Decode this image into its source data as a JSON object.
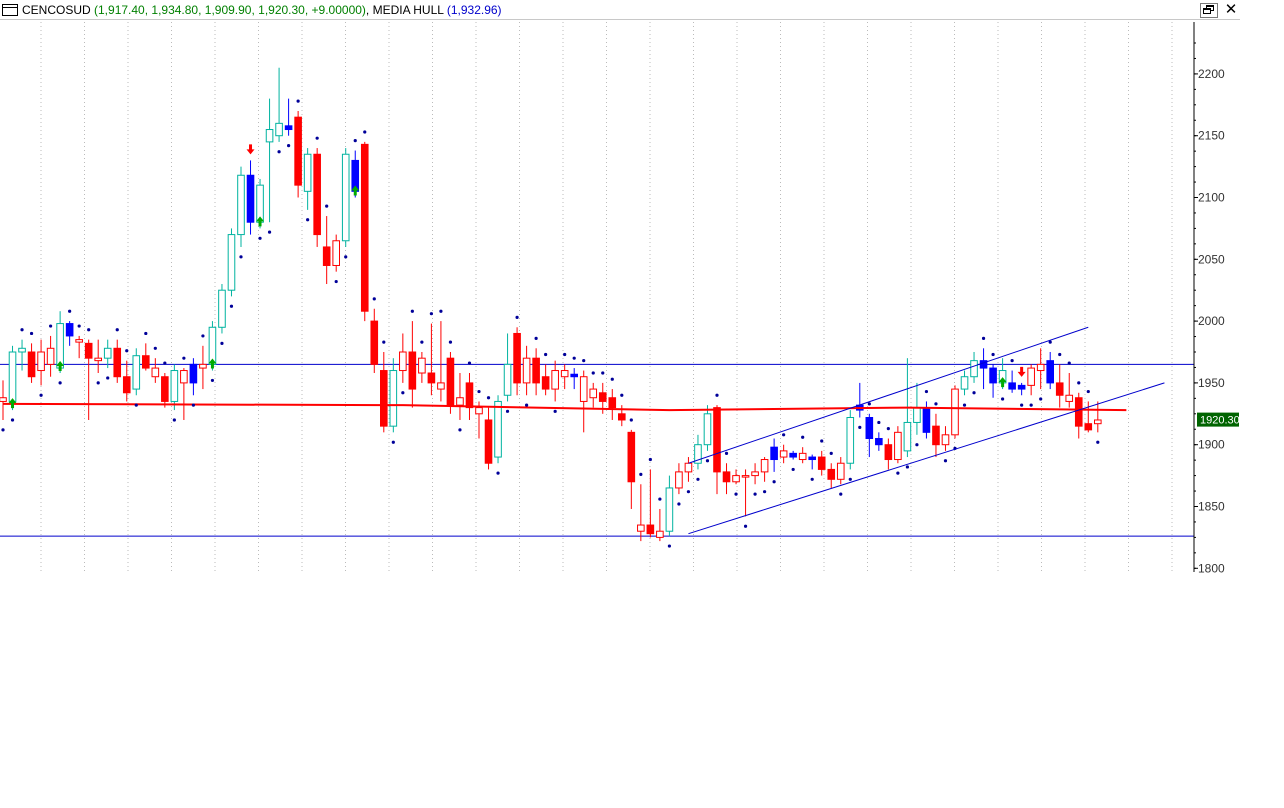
{
  "title": {
    "symbol": "CENCOSUD",
    "ohlc": "(1,917.40, 1,934.80, 1,909.90, 1,920.30, +9.00000)",
    "indicator_name": ", MEDIA HULL",
    "indicator_value": "(1,932.96)"
  },
  "window_buttons": {
    "restore_icon": "restore-icon",
    "close": "✕"
  },
  "chart_data": {
    "type": "candlestick",
    "ylim": [
      1797,
      2242
    ],
    "yticks": [
      1800,
      1850,
      1900,
      1950,
      2000,
      2050,
      2100,
      2150,
      2200
    ],
    "ytick_labels": [
      "1800",
      "1850",
      "1900",
      "1950",
      "2000",
      "2050",
      "2100",
      "2150",
      "2200"
    ],
    "last_price_label": "1920.30",
    "last_price": 1920.3,
    "colors": {
      "up_strong": "#0000ff",
      "down_strong": "#ff0000",
      "up_light": "#00b3a0",
      "down_light": "#ff0000",
      "grid": "#bbbbbb",
      "hull": "#ff0000",
      "parabolic": "#000099",
      "trend": "#0000cc",
      "signal_up": "#00aa00",
      "signal_down": "#ff0000",
      "price_tag": "#006400"
    },
    "candles": [
      {
        "o": 1935,
        "h": 1952,
        "l": 1920,
        "c": 1938,
        "s": "down_light"
      },
      {
        "o": 1935,
        "h": 1980,
        "l": 1928,
        "c": 1975,
        "s": "up_light"
      },
      {
        "o": 1978,
        "h": 1985,
        "l": 1960,
        "c": 1975,
        "s": "up_light"
      },
      {
        "o": 1975,
        "h": 1982,
        "l": 1950,
        "c": 1955,
        "s": "down_strong"
      },
      {
        "o": 1960,
        "h": 1985,
        "l": 1948,
        "c": 1975,
        "s": "down_light"
      },
      {
        "o": 1978,
        "h": 1988,
        "l": 1955,
        "c": 1965,
        "s": "down_light"
      },
      {
        "o": 1962,
        "h": 2008,
        "l": 1958,
        "c": 1998,
        "s": "up_light"
      },
      {
        "o": 1998,
        "h": 2000,
        "l": 1980,
        "c": 1988,
        "s": "up_strong"
      },
      {
        "o": 1985,
        "h": 1988,
        "l": 1970,
        "c": 1983,
        "s": "down_light"
      },
      {
        "o": 1982,
        "h": 1985,
        "l": 1920,
        "c": 1970,
        "s": "down_strong"
      },
      {
        "o": 1968,
        "h": 1985,
        "l": 1958,
        "c": 1970,
        "s": "down_light"
      },
      {
        "o": 1970,
        "h": 1985,
        "l": 1962,
        "c": 1978,
        "s": "up_light"
      },
      {
        "o": 1978,
        "h": 1985,
        "l": 1950,
        "c": 1955,
        "s": "down_strong"
      },
      {
        "o": 1955,
        "h": 1968,
        "l": 1935,
        "c": 1942,
        "s": "down_strong"
      },
      {
        "o": 1945,
        "h": 1978,
        "l": 1940,
        "c": 1972,
        "s": "up_light"
      },
      {
        "o": 1972,
        "h": 1982,
        "l": 1960,
        "c": 1962,
        "s": "down_strong"
      },
      {
        "o": 1962,
        "h": 1970,
        "l": 1950,
        "c": 1955,
        "s": "down_light"
      },
      {
        "o": 1955,
        "h": 1958,
        "l": 1930,
        "c": 1935,
        "s": "down_strong"
      },
      {
        "o": 1935,
        "h": 1965,
        "l": 1928,
        "c": 1960,
        "s": "up_light"
      },
      {
        "o": 1960,
        "h": 1962,
        "l": 1920,
        "c": 1950,
        "s": "down_light"
      },
      {
        "o": 1950,
        "h": 1970,
        "l": 1940,
        "c": 1965,
        "s": "up_strong"
      },
      {
        "o": 1965,
        "h": 1980,
        "l": 1945,
        "c": 1962,
        "s": "down_light"
      },
      {
        "o": 1965,
        "h": 2000,
        "l": 1960,
        "c": 1995,
        "s": "up_light"
      },
      {
        "o": 1995,
        "h": 2030,
        "l": 1990,
        "c": 2025,
        "s": "up_light"
      },
      {
        "o": 2025,
        "h": 2075,
        "l": 2020,
        "c": 2070,
        "s": "up_light"
      },
      {
        "o": 2070,
        "h": 2125,
        "l": 2060,
        "c": 2118,
        "s": "up_light"
      },
      {
        "o": 2118,
        "h": 2130,
        "l": 2070,
        "c": 2080,
        "s": "up_strong"
      },
      {
        "o": 2080,
        "h": 2115,
        "l": 2075,
        "c": 2110,
        "s": "up_light"
      },
      {
        "o": 2145,
        "h": 2180,
        "l": 2080,
        "c": 2155,
        "s": "up_light"
      },
      {
        "o": 2150,
        "h": 2205,
        "l": 2145,
        "c": 2160,
        "s": "up_light"
      },
      {
        "o": 2155,
        "h": 2180,
        "l": 2150,
        "c": 2158,
        "s": "up_strong"
      },
      {
        "o": 2165,
        "h": 2170,
        "l": 2100,
        "c": 2110,
        "s": "down_strong"
      },
      {
        "o": 2105,
        "h": 2140,
        "l": 2090,
        "c": 2135,
        "s": "up_light"
      },
      {
        "o": 2135,
        "h": 2140,
        "l": 2060,
        "c": 2070,
        "s": "down_strong"
      },
      {
        "o": 2060,
        "h": 2085,
        "l": 2030,
        "c": 2045,
        "s": "down_strong"
      },
      {
        "o": 2045,
        "h": 2070,
        "l": 2040,
        "c": 2065,
        "s": "down_light"
      },
      {
        "o": 2065,
        "h": 2140,
        "l": 2060,
        "c": 2135,
        "s": "up_light"
      },
      {
        "o": 2130,
        "h": 2138,
        "l": 2100,
        "c": 2105,
        "s": "up_strong"
      },
      {
        "o": 2143,
        "h": 2145,
        "l": 2000,
        "c": 2008,
        "s": "down_strong"
      },
      {
        "o": 2000,
        "h": 2010,
        "l": 1958,
        "c": 1965,
        "s": "down_strong"
      },
      {
        "o": 1960,
        "h": 1975,
        "l": 1910,
        "c": 1915,
        "s": "down_strong"
      },
      {
        "o": 1915,
        "h": 1970,
        "l": 1910,
        "c": 1960,
        "s": "up_light"
      },
      {
        "o": 1960,
        "h": 1990,
        "l": 1950,
        "c": 1975,
        "s": "down_light"
      },
      {
        "o": 1975,
        "h": 2000,
        "l": 1930,
        "c": 1945,
        "s": "down_strong"
      },
      {
        "o": 1970,
        "h": 1975,
        "l": 1950,
        "c": 1958,
        "s": "down_light"
      },
      {
        "o": 1958,
        "h": 1998,
        "l": 1940,
        "c": 1950,
        "s": "down_strong"
      },
      {
        "o": 1950,
        "h": 2000,
        "l": 1935,
        "c": 1945,
        "s": "down_light"
      },
      {
        "o": 1970,
        "h": 1975,
        "l": 1925,
        "c": 1932,
        "s": "down_strong"
      },
      {
        "o": 1932,
        "h": 1958,
        "l": 1920,
        "c": 1938,
        "s": "down_light"
      },
      {
        "o": 1950,
        "h": 1958,
        "l": 1920,
        "c": 1930,
        "s": "down_strong"
      },
      {
        "o": 1930,
        "h": 1935,
        "l": 1905,
        "c": 1925,
        "s": "down_light"
      },
      {
        "o": 1920,
        "h": 1930,
        "l": 1880,
        "c": 1885,
        "s": "down_strong"
      },
      {
        "o": 1890,
        "h": 1940,
        "l": 1885,
        "c": 1935,
        "s": "up_light"
      },
      {
        "o": 1940,
        "h": 1990,
        "l": 1935,
        "c": 1965,
        "s": "up_light"
      },
      {
        "o": 1990,
        "h": 1995,
        "l": 1940,
        "c": 1950,
        "s": "down_strong"
      },
      {
        "o": 1950,
        "h": 1980,
        "l": 1940,
        "c": 1970,
        "s": "down_light"
      },
      {
        "o": 1970,
        "h": 1978,
        "l": 1940,
        "c": 1950,
        "s": "down_strong"
      },
      {
        "o": 1955,
        "h": 1965,
        "l": 1940,
        "c": 1945,
        "s": "down_strong"
      },
      {
        "o": 1945,
        "h": 1968,
        "l": 1935,
        "c": 1960,
        "s": "down_light"
      },
      {
        "o": 1960,
        "h": 1965,
        "l": 1945,
        "c": 1955,
        "s": "down_light"
      },
      {
        "o": 1957,
        "h": 1962,
        "l": 1945,
        "c": 1955,
        "s": "up_strong"
      },
      {
        "o": 1955,
        "h": 1960,
        "l": 1910,
        "c": 1935,
        "s": "down_light"
      },
      {
        "o": 1945,
        "h": 1950,
        "l": 1930,
        "c": 1938,
        "s": "down_light"
      },
      {
        "o": 1942,
        "h": 1950,
        "l": 1925,
        "c": 1935,
        "s": "down_strong"
      },
      {
        "o": 1938,
        "h": 1945,
        "l": 1920,
        "c": 1930,
        "s": "down_strong"
      },
      {
        "o": 1925,
        "h": 1932,
        "l": 1915,
        "c": 1920,
        "s": "down_strong"
      },
      {
        "o": 1910,
        "h": 1912,
        "l": 1848,
        "c": 1870,
        "s": "down_strong"
      },
      {
        "o": 1835,
        "h": 1868,
        "l": 1822,
        "c": 1830,
        "s": "down_light"
      },
      {
        "o": 1835,
        "h": 1880,
        "l": 1825,
        "c": 1828,
        "s": "down_strong"
      },
      {
        "o": 1830,
        "h": 1848,
        "l": 1822,
        "c": 1825,
        "s": "down_light"
      },
      {
        "o": 1830,
        "h": 1875,
        "l": 1826,
        "c": 1865,
        "s": "up_light"
      },
      {
        "o": 1865,
        "h": 1885,
        "l": 1860,
        "c": 1878,
        "s": "down_light"
      },
      {
        "o": 1878,
        "h": 1890,
        "l": 1870,
        "c": 1885,
        "s": "down_light"
      },
      {
        "o": 1885,
        "h": 1908,
        "l": 1880,
        "c": 1900,
        "s": "up_light"
      },
      {
        "o": 1900,
        "h": 1932,
        "l": 1895,
        "c": 1925,
        "s": "up_light"
      },
      {
        "o": 1930,
        "h": 1932,
        "l": 1860,
        "c": 1878,
        "s": "down_strong"
      },
      {
        "o": 1878,
        "h": 1885,
        "l": 1860,
        "c": 1870,
        "s": "down_strong"
      },
      {
        "o": 1870,
        "h": 1880,
        "l": 1868,
        "c": 1875,
        "s": "down_light"
      },
      {
        "o": 1875,
        "h": 1880,
        "l": 1842,
        "c": 1875,
        "s": "down_light"
      },
      {
        "o": 1875,
        "h": 1885,
        "l": 1868,
        "c": 1878,
        "s": "down_light"
      },
      {
        "o": 1878,
        "h": 1890,
        "l": 1870,
        "c": 1888,
        "s": "down_light"
      },
      {
        "o": 1888,
        "h": 1905,
        "l": 1878,
        "c": 1898,
        "s": "up_strong"
      },
      {
        "o": 1895,
        "h": 1900,
        "l": 1885,
        "c": 1890,
        "s": "down_light"
      },
      {
        "o": 1890,
        "h": 1895,
        "l": 1888,
        "c": 1893,
        "s": "up_strong"
      },
      {
        "o": 1893,
        "h": 1898,
        "l": 1885,
        "c": 1888,
        "s": "down_light"
      },
      {
        "o": 1888,
        "h": 1892,
        "l": 1880,
        "c": 1890,
        "s": "up_strong"
      },
      {
        "o": 1890,
        "h": 1895,
        "l": 1875,
        "c": 1880,
        "s": "down_strong"
      },
      {
        "o": 1880,
        "h": 1885,
        "l": 1865,
        "c": 1872,
        "s": "down_strong"
      },
      {
        "o": 1872,
        "h": 1890,
        "l": 1868,
        "c": 1885,
        "s": "down_light"
      },
      {
        "o": 1885,
        "h": 1928,
        "l": 1880,
        "c": 1922,
        "s": "up_light"
      },
      {
        "o": 1928,
        "h": 1950,
        "l": 1922,
        "c": 1932,
        "s": "up_strong"
      },
      {
        "o": 1922,
        "h": 1925,
        "l": 1890,
        "c": 1905,
        "s": "up_strong"
      },
      {
        "o": 1905,
        "h": 1910,
        "l": 1895,
        "c": 1900,
        "s": "up_strong"
      },
      {
        "o": 1900,
        "h": 1905,
        "l": 1880,
        "c": 1888,
        "s": "down_strong"
      },
      {
        "o": 1888,
        "h": 1915,
        "l": 1885,
        "c": 1910,
        "s": "down_light"
      },
      {
        "o": 1895,
        "h": 1970,
        "l": 1890,
        "c": 1918,
        "s": "up_light"
      },
      {
        "o": 1918,
        "h": 1950,
        "l": 1908,
        "c": 1930,
        "s": "up_light"
      },
      {
        "o": 1930,
        "h": 1935,
        "l": 1905,
        "c": 1910,
        "s": "up_strong"
      },
      {
        "o": 1915,
        "h": 1925,
        "l": 1890,
        "c": 1900,
        "s": "down_strong"
      },
      {
        "o": 1900,
        "h": 1915,
        "l": 1895,
        "c": 1908,
        "s": "down_light"
      },
      {
        "o": 1908,
        "h": 1948,
        "l": 1905,
        "c": 1945,
        "s": "down_light"
      },
      {
        "o": 1945,
        "h": 1960,
        "l": 1940,
        "c": 1955,
        "s": "up_light"
      },
      {
        "o": 1955,
        "h": 1975,
        "l": 1950,
        "c": 1968,
        "s": "up_light"
      },
      {
        "o": 1968,
        "h": 1978,
        "l": 1945,
        "c": 1962,
        "s": "up_strong"
      },
      {
        "o": 1962,
        "h": 1965,
        "l": 1938,
        "c": 1950,
        "s": "up_strong"
      },
      {
        "o": 1950,
        "h": 1970,
        "l": 1945,
        "c": 1960,
        "s": "up_light"
      },
      {
        "o": 1950,
        "h": 1960,
        "l": 1942,
        "c": 1945,
        "s": "up_strong"
      },
      {
        "o": 1945,
        "h": 1950,
        "l": 1940,
        "c": 1948,
        "s": "up_strong"
      },
      {
        "o": 1948,
        "h": 1965,
        "l": 1940,
        "c": 1962,
        "s": "down_light"
      },
      {
        "o": 1960,
        "h": 1978,
        "l": 1945,
        "c": 1965,
        "s": "down_light"
      },
      {
        "o": 1968,
        "h": 1975,
        "l": 1945,
        "c": 1950,
        "s": "up_strong"
      },
      {
        "o": 1950,
        "h": 1965,
        "l": 1930,
        "c": 1940,
        "s": "down_strong"
      },
      {
        "o": 1940,
        "h": 1958,
        "l": 1930,
        "c": 1935,
        "s": "down_light"
      },
      {
        "o": 1938,
        "h": 1942,
        "l": 1905,
        "c": 1915,
        "s": "down_strong"
      },
      {
        "o": 1917,
        "h": 1935,
        "l": 1910,
        "c": 1912,
        "s": "down_strong"
      },
      {
        "o": 1917,
        "h": 1935,
        "l": 1910,
        "c": 1920,
        "s": "down_light"
      }
    ],
    "hull_line": [
      {
        "i": 0,
        "v": 1933
      },
      {
        "i": 42,
        "v": 1932
      },
      {
        "i": 70,
        "v": 1928
      },
      {
        "i": 95,
        "v": 1930
      },
      {
        "i": 118,
        "v": 1928
      }
    ],
    "horizontal_lines": [
      1965,
      1826
    ],
    "channel_upper": [
      {
        "i": 72,
        "v": 1885
      },
      {
        "i": 114,
        "v": 1995
      }
    ],
    "channel_lower": [
      {
        "i": 72,
        "v": 1828
      },
      {
        "i": 122,
        "v": 1950
      }
    ],
    "signals": [
      {
        "i": 1,
        "dir": "up"
      },
      {
        "i": 6,
        "dir": "up"
      },
      {
        "i": 22,
        "dir": "up"
      },
      {
        "i": 27,
        "dir": "up"
      },
      {
        "i": 37,
        "dir": "up"
      },
      {
        "i": 105,
        "dir": "up"
      },
      {
        "i": 26,
        "dir": "down"
      },
      {
        "i": 107,
        "dir": "down"
      }
    ]
  }
}
